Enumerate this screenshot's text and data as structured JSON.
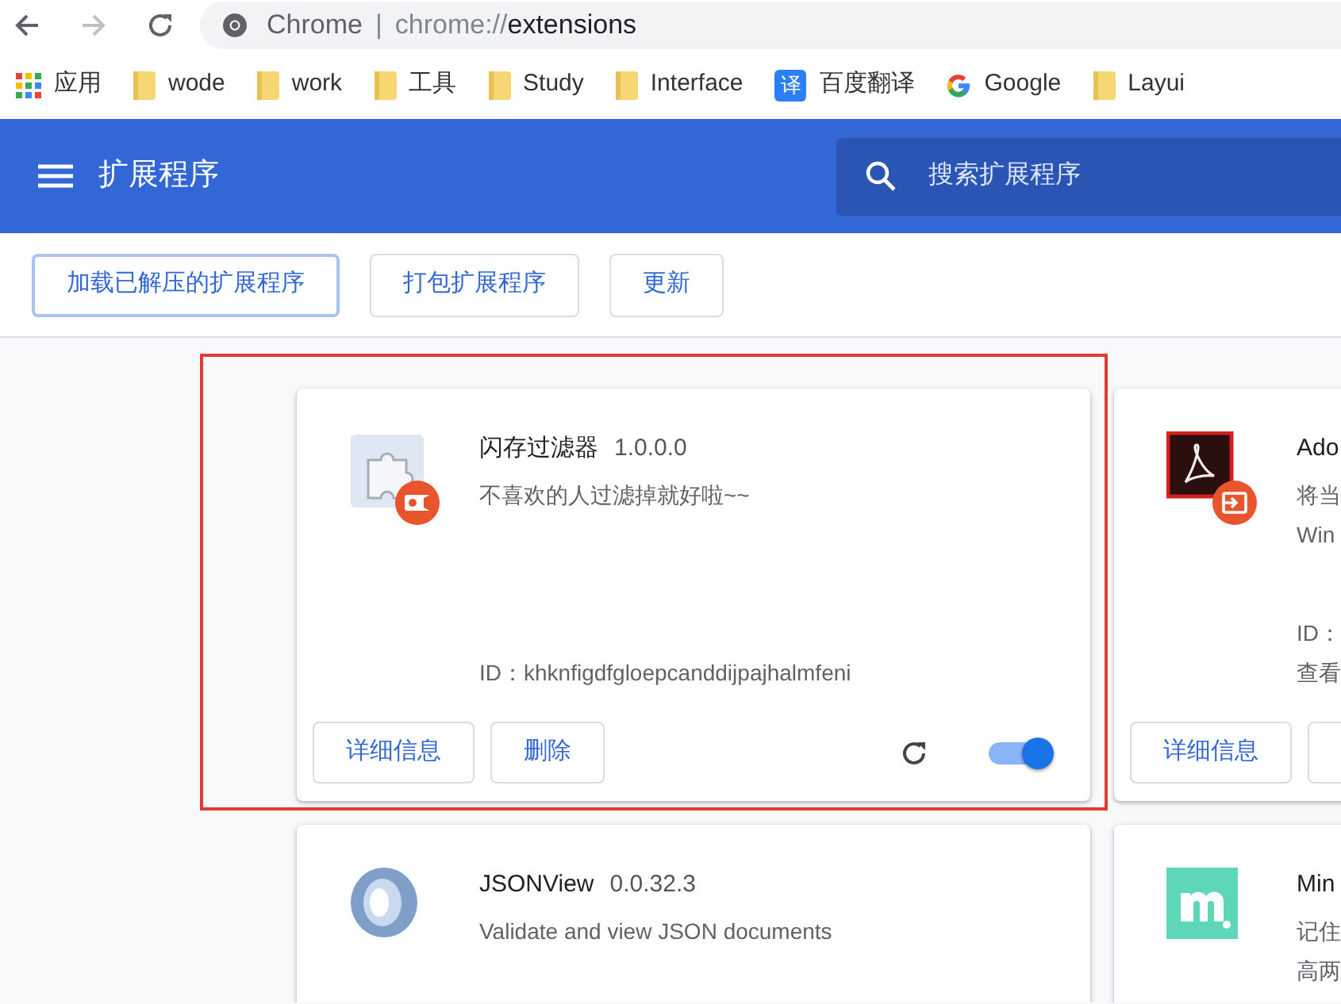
{
  "omnibox": {
    "site": "Chrome",
    "separator": "|",
    "url_scheme": "chrome://",
    "url_path": "extensions"
  },
  "bookmarks": [
    {
      "label": "应用",
      "kind": "apps"
    },
    {
      "label": "wode",
      "kind": "folder"
    },
    {
      "label": "work",
      "kind": "folder"
    },
    {
      "label": "工具",
      "kind": "folder"
    },
    {
      "label": "Study",
      "kind": "folder"
    },
    {
      "label": "Interface",
      "kind": "folder"
    },
    {
      "label": "百度翻译",
      "kind": "translate",
      "icon_text": "译"
    },
    {
      "label": "Google",
      "kind": "google"
    },
    {
      "label": "Layui",
      "kind": "folder"
    }
  ],
  "header": {
    "title": "扩展程序",
    "search_placeholder": "搜索扩展程序"
  },
  "toolbar": [
    {
      "label": "加载已解压的扩展程序",
      "focused": true
    },
    {
      "label": "打包扩展程序",
      "focused": false
    },
    {
      "label": "更新",
      "focused": false
    }
  ],
  "cards": [
    {
      "kind": "puzzle",
      "name": "闪存过滤器",
      "version": "1.0.0.0",
      "description": [
        "不喜欢的人过滤掉就好啦~~"
      ],
      "id": "ID：khknfigdfgloepcanddijpajhalmfeni",
      "buttons": [
        "详细信息",
        "删除"
      ],
      "reload": true,
      "enabled": true,
      "highlighted": true
    },
    {
      "kind": "acrobat",
      "name": "Ado",
      "description": [
        "将当",
        "Win"
      ],
      "id": "ID：",
      "link": "查看",
      "buttons": [
        "详细信息"
      ],
      "cut_button": true,
      "highlighted": false
    },
    {
      "kind": "ring",
      "name": "JSONView",
      "version": "0.0.32.3",
      "description": [
        "Validate and view JSON documents"
      ],
      "highlighted": false
    },
    {
      "kind": "mini",
      "name": "Min",
      "description": [
        "记住",
        "高两"
      ],
      "highlighted": false
    }
  ]
}
